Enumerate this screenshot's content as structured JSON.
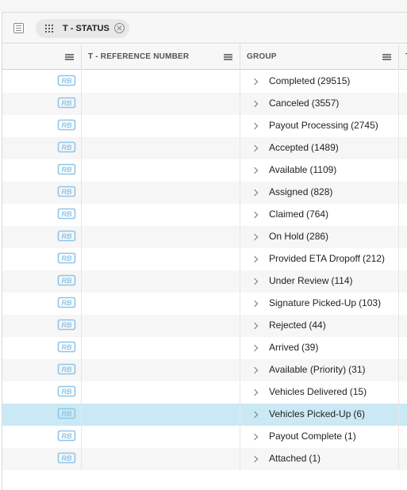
{
  "group_bar": {
    "icon": "group-panel-icon",
    "chip": {
      "label": "T - STATUS",
      "drag_icon": "drag-grip-icon",
      "remove_icon": "remove-circle-icon"
    }
  },
  "columns": [
    {
      "label": ""
    },
    {
      "label": "T - REFERENCE NUMBER"
    },
    {
      "label": "GROUP"
    },
    {
      "label": "T"
    }
  ],
  "row_icon": "rb-logo-icon",
  "rows": [
    {
      "group": "Completed",
      "count": "(29515)"
    },
    {
      "group": "Canceled",
      "count": "(3557)"
    },
    {
      "group": "Payout Processing",
      "count": "(2745)"
    },
    {
      "group": "Accepted",
      "count": "(1489)"
    },
    {
      "group": "Available",
      "count": "(1109)"
    },
    {
      "group": "Assigned",
      "count": "(828)"
    },
    {
      "group": "Claimed",
      "count": "(764)"
    },
    {
      "group": "On Hold",
      "count": "(286)"
    },
    {
      "group": "Provided ETA Dropoff",
      "count": "(212)"
    },
    {
      "group": "Under Review",
      "count": "(114)"
    },
    {
      "group": "Signature Picked-Up",
      "count": "(103)"
    },
    {
      "group": "Rejected",
      "count": "(44)"
    },
    {
      "group": "Arrived",
      "count": "(39)"
    },
    {
      "group": "Available (Priority)",
      "count": "(31)"
    },
    {
      "group": "Vehicles Delivered",
      "count": "(15)"
    },
    {
      "group": "Vehicles Picked-Up",
      "count": "(6)",
      "selected": true
    },
    {
      "group": "Payout Complete",
      "count": "(1)"
    },
    {
      "group": "Attached",
      "count": "(1)"
    }
  ],
  "colors": {
    "selected_row": "#cbe9f5",
    "logo": "#8ec5e8"
  }
}
